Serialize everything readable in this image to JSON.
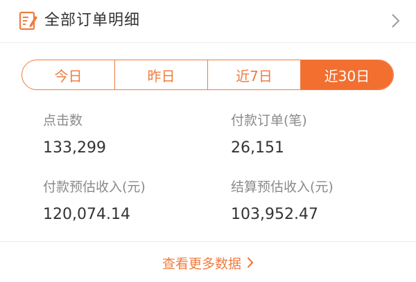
{
  "header": {
    "title": "全部订单明细",
    "icon": "order-edit-icon",
    "chevron_icon": "chevron-right-icon"
  },
  "tabs": [
    {
      "label": "今日",
      "active": false
    },
    {
      "label": "昨日",
      "active": false
    },
    {
      "label": "近7日",
      "active": false
    },
    {
      "label": "近30日",
      "active": true
    }
  ],
  "stats": {
    "clicks": {
      "label": "点击数",
      "value": "133,299"
    },
    "paid_orders": {
      "label": "付款订单(笔)",
      "value": "26,151"
    },
    "paid_estimated_income": {
      "label": "付款预估收入(元)",
      "value": "120,074.14"
    },
    "settled_estimated_income": {
      "label": "结算预估收入(元)",
      "value": "103,952.47"
    }
  },
  "footer": {
    "more_label": "查看更多数据",
    "more_icon": "chevron-right-icon"
  },
  "colors": {
    "accent": "#f26f30",
    "accent_border": "#f07b3f",
    "label_gray": "#8a8a8a",
    "value_dark": "#333333"
  }
}
